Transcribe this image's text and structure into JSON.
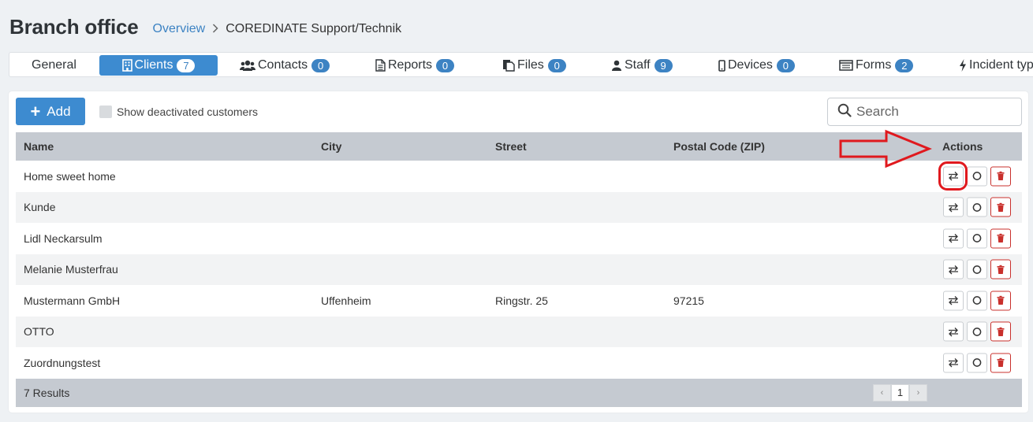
{
  "header": {
    "title": "Branch office",
    "breadcrumb_link": "Overview",
    "breadcrumb_current": "COREDINATE Support/Technik"
  },
  "tabs": [
    {
      "label": "General",
      "icon": "none"
    },
    {
      "label": "Clients",
      "count": "7",
      "icon": "building-icon",
      "active": true
    },
    {
      "label": "Contacts",
      "count": "0",
      "icon": "users-icon"
    },
    {
      "label": "Reports",
      "count": "0",
      "icon": "file-text-icon"
    },
    {
      "label": "Files",
      "count": "0",
      "icon": "files-icon"
    },
    {
      "label": "Staff",
      "count": "9",
      "icon": "user-icon"
    },
    {
      "label": "Devices",
      "count": "0",
      "icon": "mobile-icon"
    },
    {
      "label": "Forms",
      "count": "2",
      "icon": "list-icon"
    },
    {
      "label": "Incident typ",
      "icon": "bolt-icon"
    }
  ],
  "toolbar": {
    "add_label": "Add",
    "show_deactivated_label": "Show deactivated customers",
    "search_placeholder": "Search"
  },
  "table": {
    "columns": {
      "name": "Name",
      "city": "City",
      "street": "Street",
      "zip": "Postal Code (ZIP)",
      "actions": "Actions"
    },
    "rows": [
      {
        "name": "Home sweet home",
        "city": "",
        "street": "",
        "zip": ""
      },
      {
        "name": "Kunde",
        "city": "",
        "street": "",
        "zip": ""
      },
      {
        "name": "Lidl Neckarsulm",
        "city": "",
        "street": "",
        "zip": ""
      },
      {
        "name": "Melanie Musterfrau",
        "city": "",
        "street": "",
        "zip": ""
      },
      {
        "name": "Mustermann GmbH",
        "city": "Uffenheim",
        "street": "Ringstr. 25",
        "zip": "97215"
      },
      {
        "name": "OTTO",
        "city": "",
        "street": "",
        "zip": ""
      },
      {
        "name": "Zuordnungstest",
        "city": "",
        "street": "",
        "zip": ""
      }
    ],
    "results_label": "7 Results",
    "pager": {
      "prev": "‹",
      "page": "1",
      "next": "›"
    }
  },
  "colors": {
    "accent": "#3d8bd0",
    "badge": "#3d83c3",
    "danger": "#c9302c",
    "annotation": "#e0191e"
  }
}
